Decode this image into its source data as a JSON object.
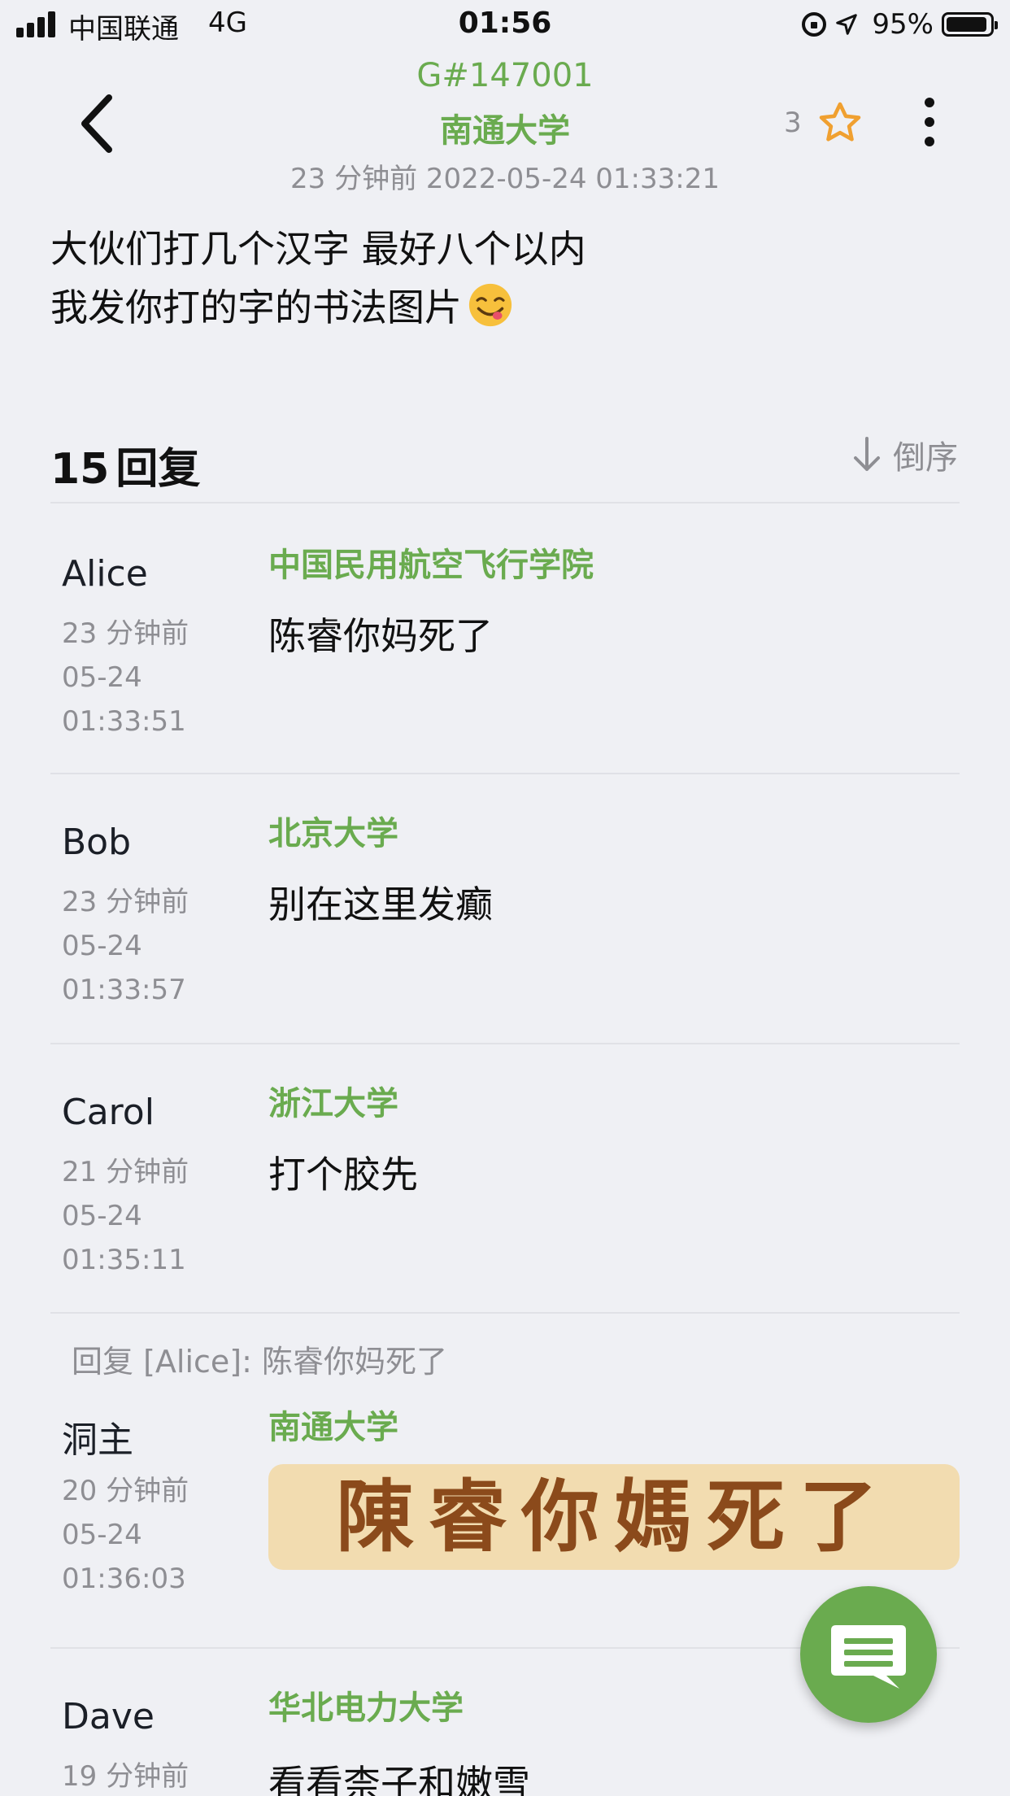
{
  "status_bar": {
    "carrier": "中国联通",
    "network": "4G",
    "time": "01:56",
    "battery_percent": "95%",
    "battery_level": 0.95
  },
  "header": {
    "post_id": "G#147001",
    "school": "南通大学",
    "time": "23 分钟前 2022-05-24 01:33:21",
    "star_count": "3",
    "icons": {
      "back": "chevron-left-icon",
      "star": "star-outline-icon",
      "more": "more-vertical-icon"
    }
  },
  "post": {
    "line1": "大伙们打几个汉字 最好八个以内",
    "line2": "我发你打的字的书法图片",
    "emoji": "yum-face-emoji"
  },
  "replies_header": {
    "count": "15",
    "label": "回复",
    "sort_label": "倒序"
  },
  "replies": [
    {
      "name": "Alice",
      "rel": "23 分钟前",
      "date": "05-24",
      "time": "01:33:51",
      "school": "中国民用航空飞行学院",
      "text": "陈睿你妈死了"
    },
    {
      "name": "Bob",
      "rel": "23 分钟前",
      "date": "05-24",
      "time": "01:33:57",
      "school": "北京大学",
      "text": "别在这里发癫"
    },
    {
      "name": "Carol",
      "rel": "21 分钟前",
      "date": "05-24",
      "time": "01:35:11",
      "school": "浙江大学",
      "text": "打个胶先"
    },
    {
      "quote": "回复 [Alice]: 陈睿你妈死了",
      "name": "洞主",
      "rel": "20 分钟前",
      "date": "05-24",
      "time": "01:36:03",
      "school": "南通大学",
      "image_text": "陳睿你媽死了"
    },
    {
      "name": "Dave",
      "rel": "19 分钟前",
      "school": "华北电力大学",
      "text": "看看柰子和嫩雪"
    }
  ],
  "fab": {
    "icon": "comment-icon",
    "color": "#6aab4f"
  },
  "colors": {
    "accent_green": "#6aab4f",
    "star_orange": "#f0a030",
    "meta_gray": "#8e8e93",
    "background": "#eff0f4"
  }
}
